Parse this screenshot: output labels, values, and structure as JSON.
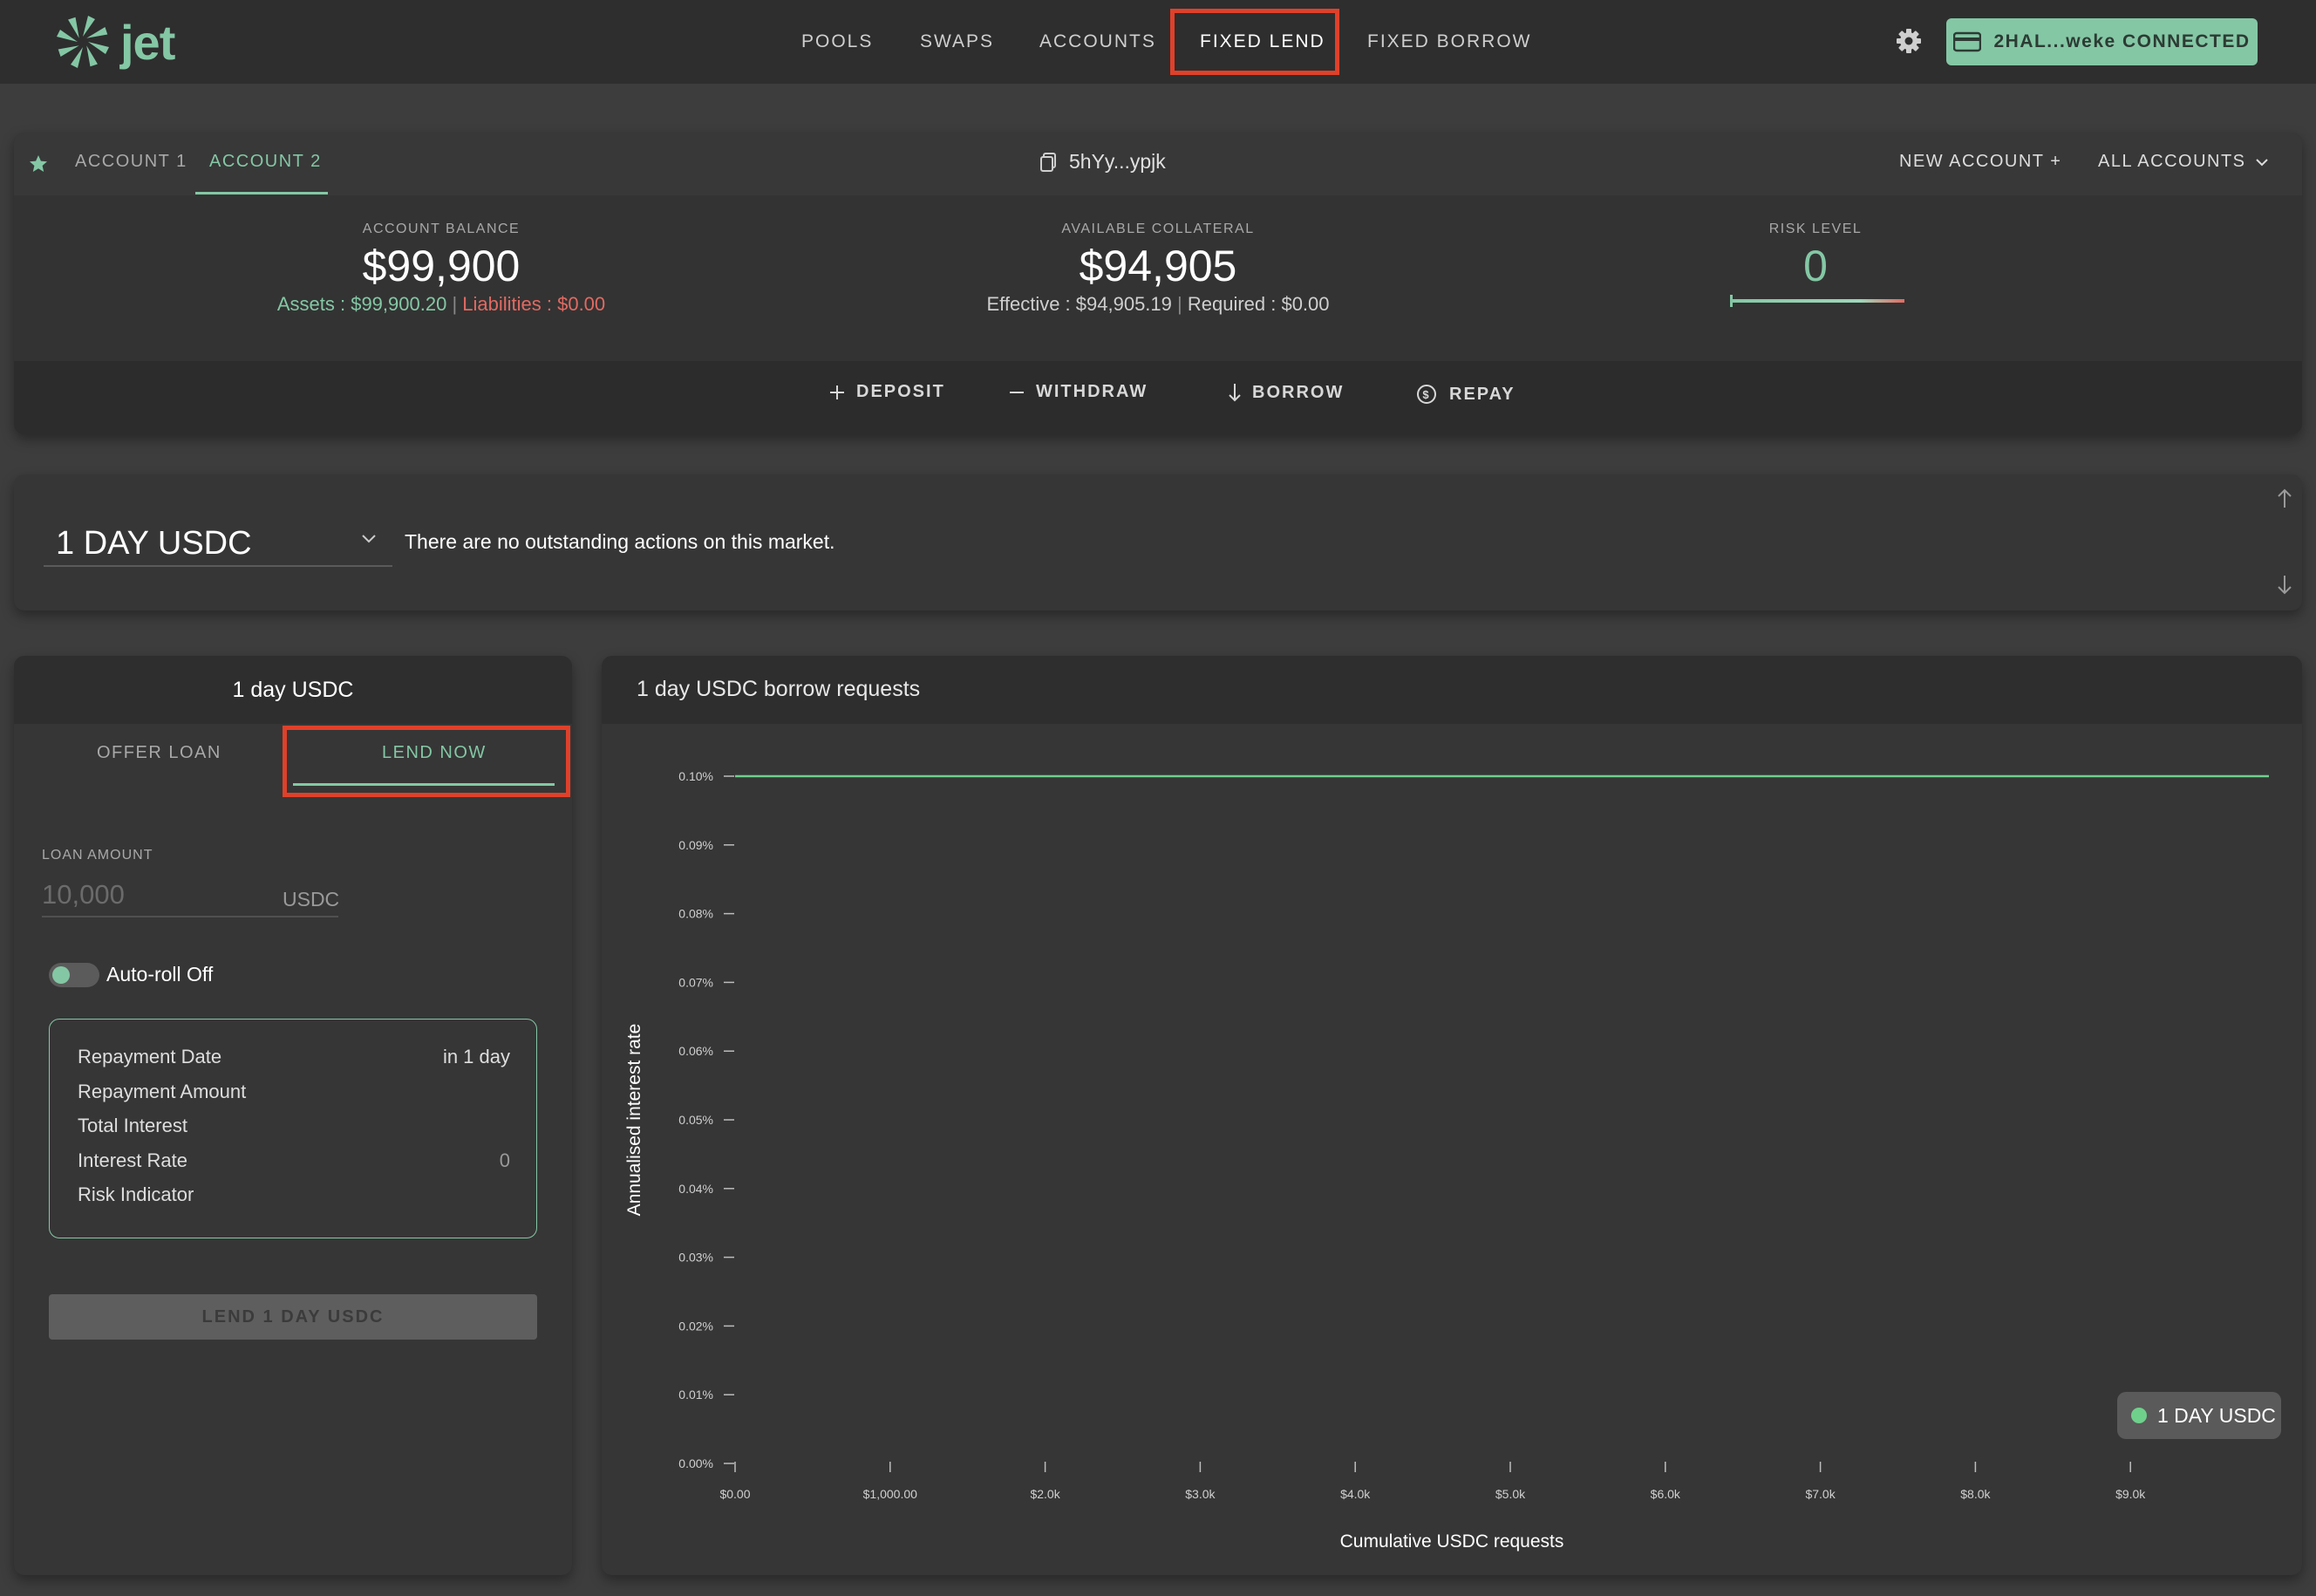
{
  "nav": {
    "items": [
      "POOLS",
      "SWAPS",
      "ACCOUNTS",
      "FIXED LEND",
      "FIXED BORROW"
    ],
    "active": "FIXED LEND",
    "wallet_label": "2HAL...weke CONNECTED"
  },
  "logo": {
    "text": "jet"
  },
  "accounts": {
    "tabs": [
      "ACCOUNT 1",
      "ACCOUNT 2"
    ],
    "active": "ACCOUNT 2",
    "address": "5hYy...ypjk",
    "new_account": "NEW ACCOUNT +",
    "all_accounts": "ALL ACCOUNTS"
  },
  "balance": {
    "label": "ACCOUNT BALANCE",
    "value": "$99,900",
    "assets": "Assets : $99,900.20",
    "liabilities": "Liabilities : $0.00"
  },
  "collateral": {
    "label": "AVAILABLE COLLATERAL",
    "value": "$94,905",
    "effective": "Effective : $94,905.19",
    "required": "Required : $0.00"
  },
  "risk": {
    "label": "RISK LEVEL",
    "value": "0"
  },
  "actions": {
    "deposit": "DEPOSIT",
    "withdraw": "WITHDRAW",
    "borrow": "BORROW",
    "repay": "REPAY"
  },
  "market": {
    "selected": "1 DAY USDC",
    "message": "There are no outstanding actions on this market."
  },
  "lend": {
    "title": "1 day USDC",
    "tabs": [
      "OFFER LOAN",
      "LEND NOW"
    ],
    "active_tab": "LEND NOW",
    "loan_amount_label": "LOAN AMOUNT",
    "loan_amount_placeholder": "10,000",
    "unit": "USDC",
    "autoroll_label": "Auto-roll Off",
    "summary": {
      "repayment_date_label": "Repayment Date",
      "repayment_date_value": "in 1 day",
      "repayment_amount_label": "Repayment Amount",
      "total_interest_label": "Total Interest",
      "interest_rate_label": "Interest Rate",
      "interest_rate_value": "0",
      "risk_indicator_label": "Risk Indicator"
    },
    "submit_label": "LEND 1 DAY USDC"
  },
  "chart": {
    "panel_title": "1 day USDC borrow requests",
    "legend": "1 DAY USDC",
    "series_color": "#6fd08c"
  },
  "colors": {
    "accent": "#84c7a5",
    "highlight": "#e0402a",
    "danger": "#e16a62"
  },
  "chart_data": {
    "type": "line",
    "title": "1 day USDC borrow requests",
    "xlabel": "Cumulative USDC requests",
    "ylabel": "Annualised interest rate",
    "x_ticks": [
      "$0.00",
      "$1,000.00",
      "$2.0k",
      "$3.0k",
      "$4.0k",
      "$5.0k",
      "$6.0k",
      "$7.0k",
      "$8.0k",
      "$9.0k"
    ],
    "y_ticks": [
      "0.00%",
      "0.01%",
      "0.02%",
      "0.03%",
      "0.04%",
      "0.05%",
      "0.06%",
      "0.07%",
      "0.08%",
      "0.09%",
      "0.10%"
    ],
    "xlim": [
      0,
      10000
    ],
    "ylim": [
      0,
      0.1
    ],
    "series": [
      {
        "name": "1 DAY USDC",
        "x": [
          0,
          10000
        ],
        "y": [
          0.1,
          0.1
        ]
      }
    ],
    "legend_position": "bottom-right"
  }
}
